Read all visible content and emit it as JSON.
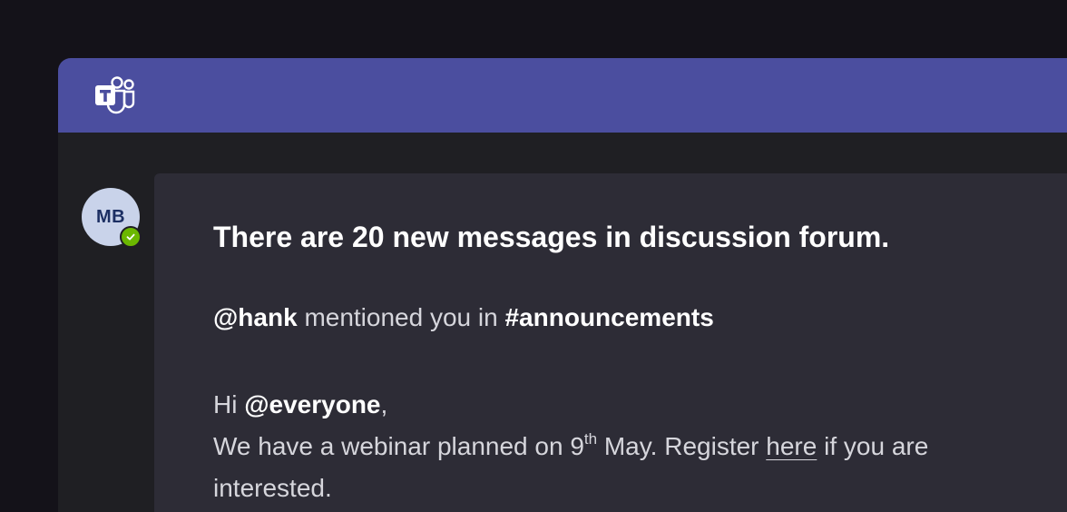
{
  "app": {
    "logo_icon": "microsoft-teams-icon",
    "titlebar_color": "#4b4e9f"
  },
  "message": {
    "avatar_initials": "MB",
    "presence_status_icon": "available-check-icon",
    "headline": "There are 20 new messages in discussion forum.",
    "mention": {
      "user": "@hank",
      "text": "mentioned you in",
      "channel": "#announcements"
    },
    "greeting": {
      "prefix": "Hi",
      "target": "@everyone",
      "suffix": ","
    },
    "body": {
      "part1": "We have a webinar planned on 9",
      "superscript": "th",
      "part2": "May. Register",
      "link_text": "here",
      "part3": "if you are",
      "part4": "interested."
    }
  }
}
